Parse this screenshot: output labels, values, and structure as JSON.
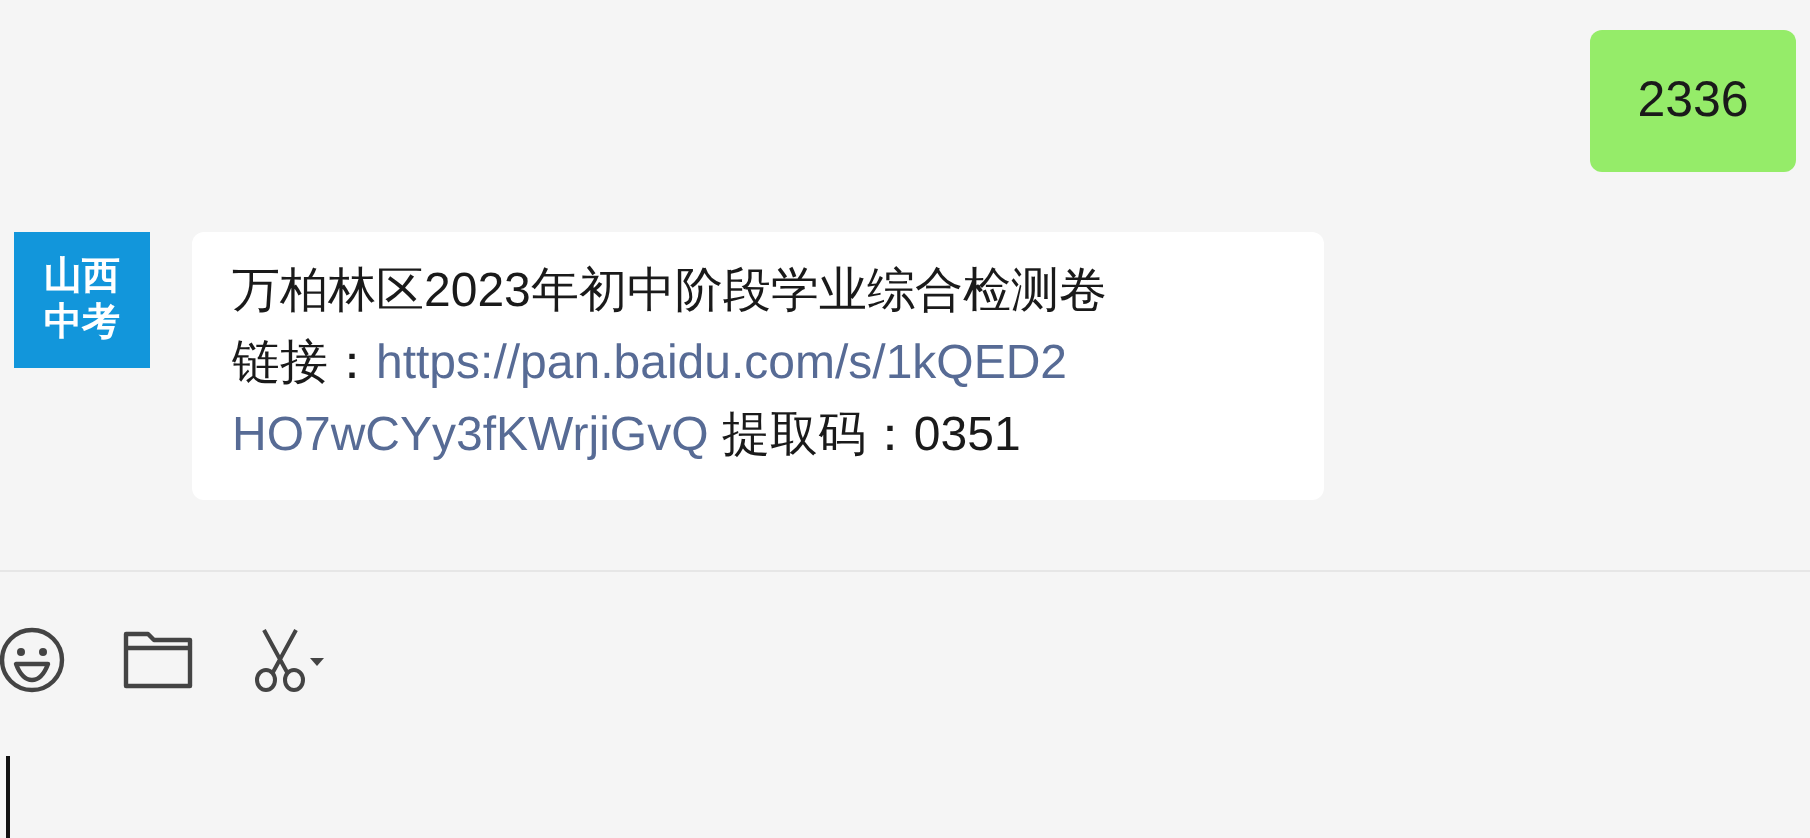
{
  "messages": [
    {
      "kind": "sent",
      "text": "2336"
    },
    {
      "kind": "received",
      "avatar": [
        "山西",
        "中考"
      ],
      "title": "万柏林区2023年初中阶段学业综合检测卷",
      "link_label": "链接：",
      "url_lines": [
        "https://pan.baidu.com/s/1kQED2",
        "HO7wCYy3fKWrjiGvQ"
      ],
      "code_label": "提取码：",
      "code": "0351"
    }
  ]
}
